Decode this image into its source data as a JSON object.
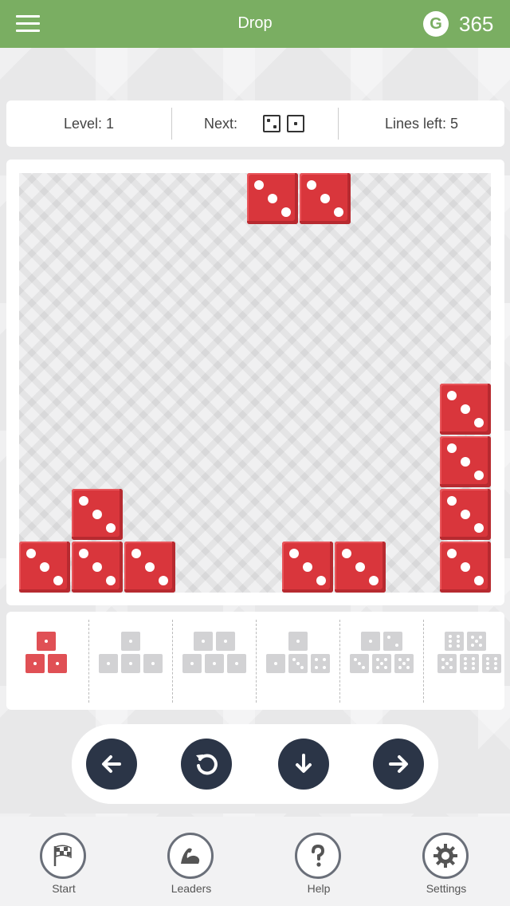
{
  "header": {
    "title": "Drop",
    "coin_symbol": "G",
    "coin_count": "365",
    "menu_icon": "hamburger-menu-icon",
    "accent_color": "#7aae62"
  },
  "infobar": {
    "level_text": "Level: 1",
    "next_label": "Next:",
    "next_dice": [
      2,
      1
    ],
    "lines_left_text": "Lines left: 5"
  },
  "board": {
    "die_color": "#d9363c",
    "die_face": 3,
    "falling_piece": [
      "die-3",
      "die-3"
    ],
    "placed_dice_count": 10
  },
  "shapes_tray": {
    "selected_index": 0,
    "items": [
      "shape-3-dice-red",
      "shape-4-dice",
      "shape-5-dice",
      "shape-4-dice-mixed",
      "shape-5-dice-mixed",
      "shape-7-dice"
    ]
  },
  "controls": {
    "buttons": [
      "move-left",
      "rotate",
      "drop",
      "move-right"
    ],
    "button_color": "#2b3547"
  },
  "nav": {
    "items": [
      {
        "label": "Start",
        "icon": "checkered-flag-icon"
      },
      {
        "label": "Leaders",
        "icon": "flexed-arm-icon"
      },
      {
        "label": "Help",
        "icon": "question-mark-icon"
      },
      {
        "label": "Settings",
        "icon": "gear-icon"
      }
    ]
  }
}
